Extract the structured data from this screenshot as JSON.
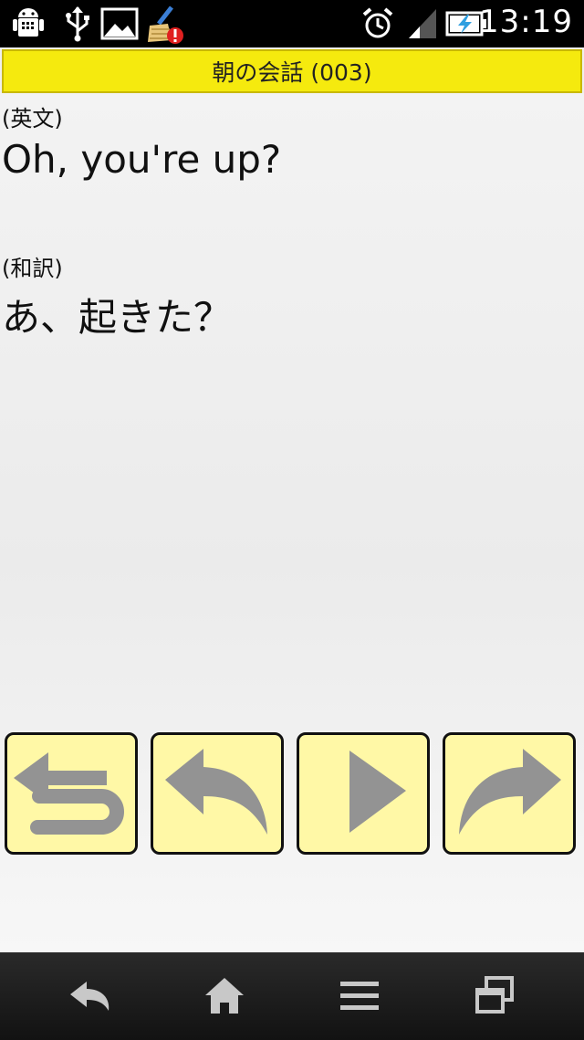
{
  "status_bar": {
    "time": "13:19",
    "icons_left": [
      "android-debug-icon",
      "usb-icon",
      "image-notification-icon",
      "cleaner-alert-icon"
    ],
    "icons_right": [
      "alarm-icon",
      "signal-icon",
      "battery-charging-icon"
    ]
  },
  "header": {
    "title": "朝の会話 (003)"
  },
  "main": {
    "english_label": "(英文)",
    "english_text": "Oh, you're up?",
    "japanese_label": "(和訳)",
    "japanese_text": "あ、起きた？"
  },
  "controls": [
    {
      "name": "return-button",
      "icon": "return-arrow-icon"
    },
    {
      "name": "previous-button",
      "icon": "back-arrow-icon"
    },
    {
      "name": "play-button",
      "icon": "play-icon"
    },
    {
      "name": "next-button",
      "icon": "forward-arrow-icon"
    }
  ],
  "nav_bar": {
    "buttons": [
      "back-icon",
      "home-icon",
      "menu-icon",
      "recent-apps-icon"
    ]
  },
  "colors": {
    "title_bg": "#f5ea0e",
    "button_bg": "#fff8a6",
    "icon_gray": "#909090"
  }
}
